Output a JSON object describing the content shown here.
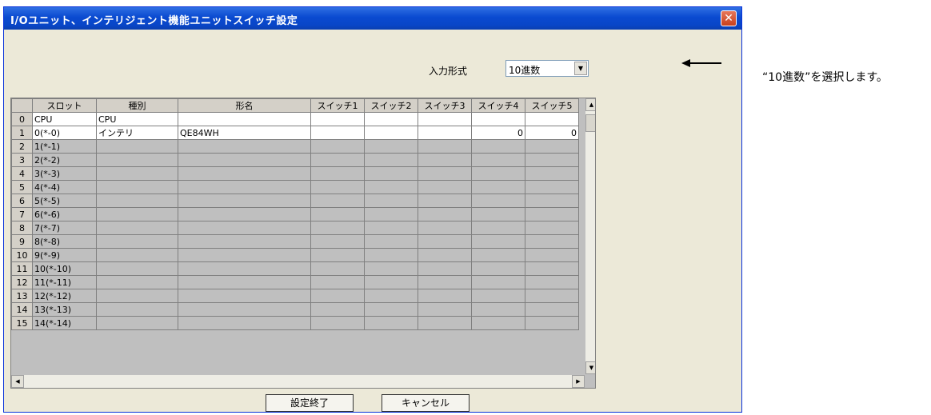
{
  "window": {
    "title": "I/Oユニット、インテリジェント機能ユニットスイッチ設定"
  },
  "input_format": {
    "label": "入力形式",
    "selected": "10進数"
  },
  "grid": {
    "headers": [
      "スロット",
      "種別",
      "形名",
      "スイッチ1",
      "スイッチ2",
      "スイッチ3",
      "スイッチ4",
      "スイッチ5"
    ],
    "rows": [
      {
        "idx": "0",
        "slot": "CPU",
        "type": "CPU",
        "model": "",
        "sw": [
          "",
          "",
          "",
          "",
          ""
        ]
      },
      {
        "idx": "1",
        "slot": "0(*-0)",
        "type": "インテリ",
        "model": "QE84WH",
        "sw": [
          "",
          "",
          "",
          "0",
          "0"
        ]
      },
      {
        "idx": "2",
        "slot": "1(*-1)",
        "type": "",
        "model": "",
        "sw": [
          "",
          "",
          "",
          "",
          ""
        ]
      },
      {
        "idx": "3",
        "slot": "2(*-2)",
        "type": "",
        "model": "",
        "sw": [
          "",
          "",
          "",
          "",
          ""
        ]
      },
      {
        "idx": "4",
        "slot": "3(*-3)",
        "type": "",
        "model": "",
        "sw": [
          "",
          "",
          "",
          "",
          ""
        ]
      },
      {
        "idx": "5",
        "slot": "4(*-4)",
        "type": "",
        "model": "",
        "sw": [
          "",
          "",
          "",
          "",
          ""
        ]
      },
      {
        "idx": "6",
        "slot": "5(*-5)",
        "type": "",
        "model": "",
        "sw": [
          "",
          "",
          "",
          "",
          ""
        ]
      },
      {
        "idx": "7",
        "slot": "6(*-6)",
        "type": "",
        "model": "",
        "sw": [
          "",
          "",
          "",
          "",
          ""
        ]
      },
      {
        "idx": "8",
        "slot": "7(*-7)",
        "type": "",
        "model": "",
        "sw": [
          "",
          "",
          "",
          "",
          ""
        ]
      },
      {
        "idx": "9",
        "slot": "8(*-8)",
        "type": "",
        "model": "",
        "sw": [
          "",
          "",
          "",
          "",
          ""
        ]
      },
      {
        "idx": "10",
        "slot": "9(*-9)",
        "type": "",
        "model": "",
        "sw": [
          "",
          "",
          "",
          "",
          ""
        ]
      },
      {
        "idx": "11",
        "slot": "10(*-10)",
        "type": "",
        "model": "",
        "sw": [
          "",
          "",
          "",
          "",
          ""
        ]
      },
      {
        "idx": "12",
        "slot": "11(*-11)",
        "type": "",
        "model": "",
        "sw": [
          "",
          "",
          "",
          "",
          ""
        ]
      },
      {
        "idx": "13",
        "slot": "12(*-12)",
        "type": "",
        "model": "",
        "sw": [
          "",
          "",
          "",
          "",
          ""
        ]
      },
      {
        "idx": "14",
        "slot": "13(*-13)",
        "type": "",
        "model": "",
        "sw": [
          "",
          "",
          "",
          "",
          ""
        ]
      },
      {
        "idx": "15",
        "slot": "14(*-14)",
        "type": "",
        "model": "",
        "sw": [
          "",
          "",
          "",
          "",
          ""
        ]
      }
    ]
  },
  "buttons": {
    "ok": "設定終了",
    "cancel": "キャンセル"
  },
  "annotation": {
    "text": "“10進数”を選択します。"
  },
  "colors": {
    "titlebar": "#0a4ad0",
    "window_bg": "#ece9d8",
    "close": "#c8401c"
  }
}
